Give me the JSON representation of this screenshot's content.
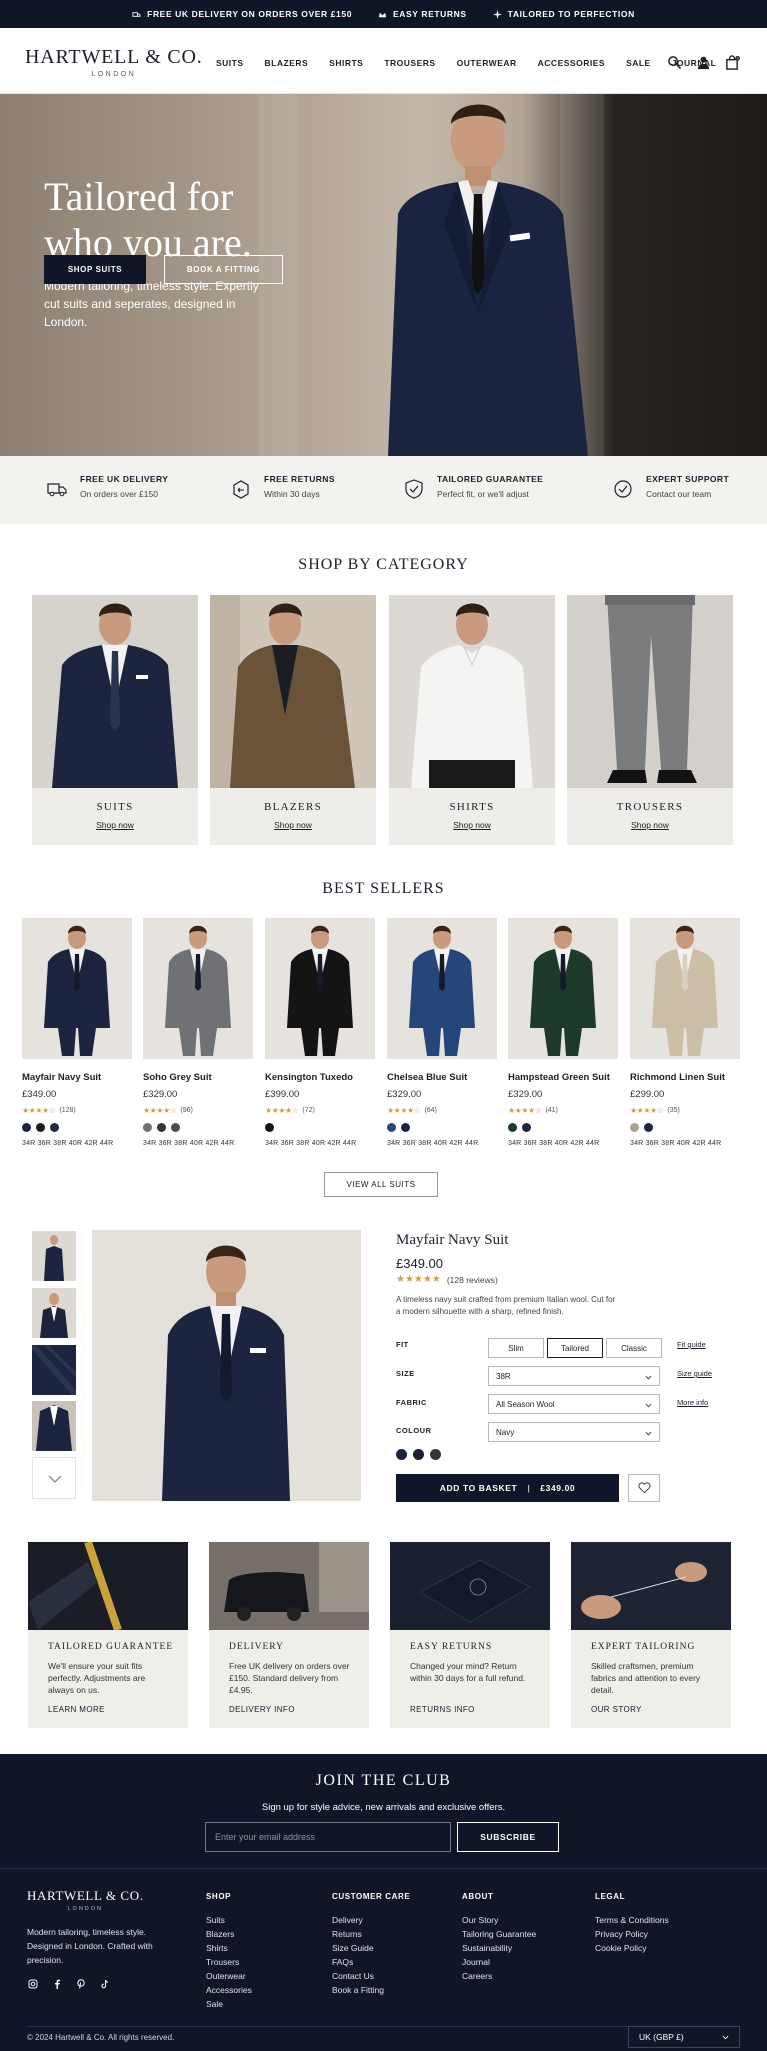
{
  "announcement": [
    {
      "icon": "truck-icon",
      "text": "FREE UK DELIVERY ON ORDERS OVER £150"
    },
    {
      "icon": "crown-icon",
      "text": "EASY RETURNS"
    },
    {
      "icon": "sparkle-icon",
      "text": "TAILORED TO PERFECTION"
    }
  ],
  "brand": {
    "name": "HARTWELL & CO.",
    "location": "LONDON"
  },
  "nav": [
    "SUITS",
    "BLAZERS",
    "SHIRTS",
    "TROUSERS",
    "OUTERWEAR",
    "ACCESSORIES",
    "SALE",
    "JOURNAL"
  ],
  "header_icons": [
    "search-icon",
    "account-icon",
    "bag-icon"
  ],
  "bag_count": "0",
  "hero": {
    "title_line1": "Tailored for",
    "title_line2": "who you are.",
    "subtitle": "Modern tailoring, timeless style. Expertly cut suits and seperates, designed in London.",
    "primary_button": "SHOP SUITS",
    "secondary_button": "BOOK A FITTING"
  },
  "benefits": [
    {
      "icon": "truck-icon",
      "title": "FREE UK DELIVERY",
      "sub": "On orders over £150"
    },
    {
      "icon": "return-box-icon",
      "title": "FREE RETURNS",
      "sub": "Within 30 days"
    },
    {
      "icon": "shield-check-icon",
      "title": "TAILORED GUARANTEE",
      "sub": "Perfect fit, or we'll adjust"
    },
    {
      "icon": "chat-check-icon",
      "title": "EXPERT SUPPORT",
      "sub": "Contact our team"
    }
  ],
  "categories_title": "SHOP BY CATEGORY",
  "categories": [
    {
      "label": "SUITS",
      "link": "Shop now"
    },
    {
      "label": "BLAZERS",
      "link": "Shop now"
    },
    {
      "label": "SHIRTS",
      "link": "Shop now"
    },
    {
      "label": "TROUSERS",
      "link": "Shop now"
    }
  ],
  "best_sellers_title": "BEST SELLERS",
  "products": [
    {
      "name": "Mayfair Navy Suit",
      "price": "£349.00",
      "reviews": "(128)",
      "rating": 4.5,
      "suit_color": "#1c2440",
      "swatches": [
        "#1c2440",
        "#1a1a1a",
        "#222a3a"
      ],
      "sizes": "34R  36R  38R  40R  42R  44R"
    },
    {
      "name": "Soho Grey Suit",
      "price": "£329.00",
      "reviews": "(96)",
      "rating": 4.5,
      "suit_color": "#6f7174",
      "swatches": [
        "#6f7174",
        "#33363b",
        "#4a4d50"
      ],
      "sizes": "34R  36R  38R  40R  42R  44R"
    },
    {
      "name": "Kensington Tuxedo",
      "price": "£399.00",
      "reviews": "(72)",
      "rating": 4.5,
      "suit_color": "#141414",
      "swatches": [
        "#141414"
      ],
      "sizes": "34R  36R  38R  40R  42R  44R"
    },
    {
      "name": "Chelsea Blue Suit",
      "price": "£329.00",
      "reviews": "(64)",
      "rating": 4.5,
      "suit_color": "#25467a",
      "swatches": [
        "#25467a",
        "#1c2440"
      ],
      "sizes": "34R  36R  38R  40R  42R  44R"
    },
    {
      "name": "Hampstead Green Suit",
      "price": "£329.00",
      "reviews": "(41)",
      "rating": 4.5,
      "suit_color": "#1e3a2b",
      "swatches": [
        "#1e3a2b",
        "#1c2440"
      ],
      "sizes": "34R  36R  38R  40R  42R  44R"
    },
    {
      "name": "Richmond Linen Suit",
      "price": "£299.00",
      "reviews": "(35)",
      "rating": 4.5,
      "suit_color": "#cbbfa8",
      "swatches": [
        "#a9a294",
        "#1c2440"
      ],
      "sizes": "34R  36R  38R  40R  42R  44R"
    }
  ],
  "view_all": "VIEW ALL SUITS",
  "detail": {
    "title": "Mayfair Navy Suit",
    "price": "£349.00",
    "reviews": "(128 reviews)",
    "description": "A timeless navy suit crafted from premium Italian wool. Cut for a modern silhouette with a sharp, refined finish.",
    "fit_label": "FIT",
    "fit_options": [
      "Slim",
      "Tailored",
      "Classic"
    ],
    "fit_selected": "Tailored",
    "fit_link": "Fit guide",
    "size_label": "SIZE",
    "size_value": "38R",
    "size_link": "Size guide",
    "fabric_label": "FABRIC",
    "fabric_value": "All Season Wool",
    "fabric_link": "More info",
    "colour_label": "COLOUR",
    "colour_value": "Navy",
    "colour_swatches": [
      "#1c2440",
      "#1a2030",
      "#34363d"
    ],
    "add_button": "ADD TO BASKET",
    "add_price": "£349.00"
  },
  "services": [
    {
      "title": "TAILORED GUARANTEE",
      "desc": "We'll ensure your suit fits perfectly. Adjustments are always on us.",
      "link": "LEARN MORE"
    },
    {
      "title": "DELIVERY",
      "desc": "Free UK delivery on orders over £150. Standard delivery from £4.95.",
      "link": "DELIVERY INFO"
    },
    {
      "title": "EASY RETURNS",
      "desc": "Changed your mind? Return within 30 days for a full refund.",
      "link": "RETURNS INFO"
    },
    {
      "title": "EXPERT TAILORING",
      "desc": "Skilled craftsmen, premium fabrics and attention to every detail.",
      "link": "OUR STORY"
    }
  ],
  "club": {
    "title": "JOIN THE CLUB",
    "subtitle": "Sign up for style advice, new arrivals and exclusive offers.",
    "placeholder": "Enter your email address",
    "button": "SUBSCRIBE"
  },
  "footer": {
    "tagline": "Modern tailoring, timeless style. Designed in London. Crafted with precision.",
    "social": [
      "instagram-icon",
      "facebook-icon",
      "pinterest-icon",
      "tiktok-icon"
    ],
    "columns": [
      {
        "heading": "SHOP",
        "items": [
          "Suits",
          "Blazers",
          "Shirts",
          "Trousers",
          "Outerwear",
          "Accessories",
          "Sale"
        ]
      },
      {
        "heading": "CUSTOMER CARE",
        "items": [
          "Delivery",
          "Returns",
          "Size Guide",
          "FAQs",
          "Contact Us",
          "Book a Fitting"
        ]
      },
      {
        "heading": "ABOUT",
        "items": [
          "Our Story",
          "Tailoring Guarantee",
          "Sustainability",
          "Journal",
          "Careers"
        ]
      },
      {
        "heading": "LEGAL",
        "items": [
          "Terms & Conditions",
          "Privacy Policy",
          "Cookie Policy"
        ]
      }
    ],
    "copyright": "© 2024 Hartwell & Co. All rights reserved.",
    "region": "UK (GBP £)"
  }
}
